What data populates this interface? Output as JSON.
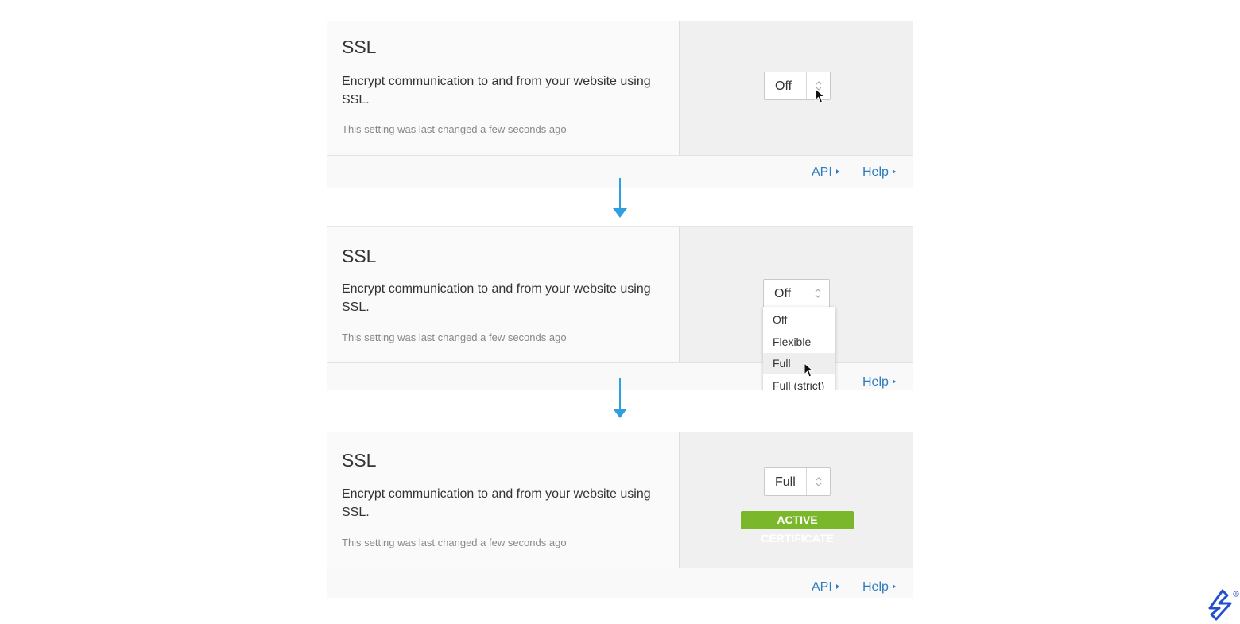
{
  "panels": [
    {
      "title": "SSL",
      "description": "Encrypt communication to and from your website using SSL.",
      "note": "This setting was last changed a few seconds ago",
      "select_value": "Off",
      "api_label": "API",
      "help_label": "Help"
    },
    {
      "title": "SSL",
      "description": "Encrypt communication to and from your website using SSL.",
      "note": "This setting was last changed a few seconds ago",
      "select_value": "Off",
      "dropdown_options": [
        "Off",
        "Flexible",
        "Full",
        "Full (strict)"
      ],
      "hovered_option": "Full",
      "help_label": "Help"
    },
    {
      "title": "SSL",
      "description": "Encrypt communication to and from your website using SSL.",
      "note": "This setting was last changed a few seconds ago",
      "select_value": "Full",
      "badge": "ACTIVE CERTIFICATE",
      "api_label": "API",
      "help_label": "Help"
    }
  ],
  "colors": {
    "link": "#2f7bbf",
    "arrow": "#2f9fe0",
    "badge": "#7bb72b",
    "logo": "#204ecf"
  },
  "icons": [
    "up-down-arrows-icon",
    "mouse-pointer-icon",
    "down-arrow-icon",
    "caret-right-icon",
    "toptal-logo-icon"
  ]
}
